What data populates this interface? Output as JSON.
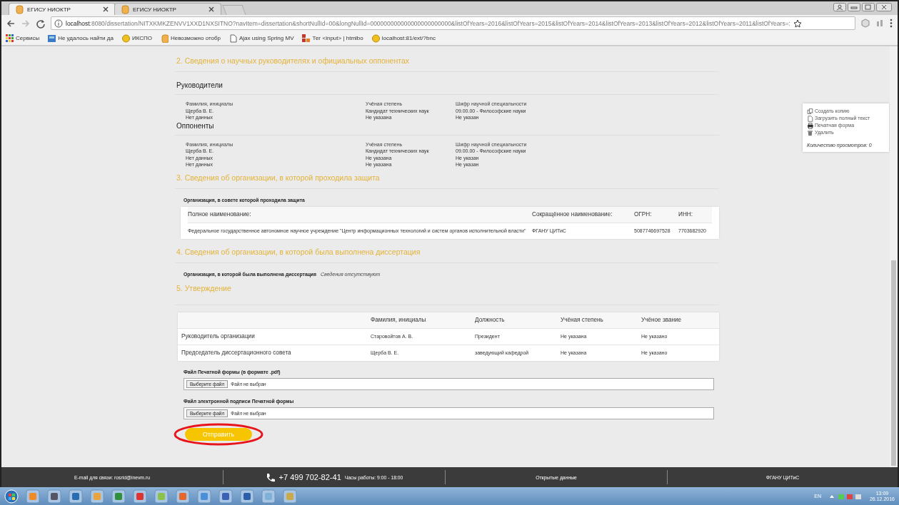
{
  "browser": {
    "tabs": [
      {
        "title": "ЕГИСУ НИОКТР",
        "selected": true
      },
      {
        "title": "ЕГИСУ НИОКТР",
        "selected": false
      }
    ],
    "address_host": "localhost",
    "address_path": ":8080/dissertation/NITXKMKZENVV1XXD1NXSITNO?navItem=dissertation&shortNullId=00&longNullId=000000000000000000000000&listOfYears=2016&listOfYears=2015&listOfYears=2014&listOfYears=2013&listOfYears=2012&listOfYears=2011&listOfYears=:",
    "bookmarks": [
      "Сервисы",
      "Не удалось найти да",
      "ИКСПО",
      "Невозможно отобр",
      "Ajax using Spring MV",
      "Тег <input> | htmlbo",
      "localhost:81/ext/?bnc"
    ]
  },
  "section_2": {
    "title": "2. Сведения о научных руководителях и официальных оппонентах",
    "groups": [
      {
        "heading": "Руководители",
        "columns": [
          "Фамилия, инициалы",
          "Учёная степень",
          "Шифр научной специальности"
        ],
        "rows": [
          [
            "Щерба В. Е.",
            "Кандидат технических наук",
            "09.00.00 - Философские науки"
          ],
          [
            "Нет данных",
            "Не указана",
            "Не указан"
          ]
        ]
      },
      {
        "heading": "Оппоненты",
        "columns": [
          "Фамилия, инициалы",
          "Учёная степень",
          "Шифр научной специальности"
        ],
        "rows": [
          [
            "Щерба В. Е.",
            "Кандидат технических наук",
            "09.00.00 - Философские науки"
          ],
          [
            "Нет данных",
            "Не указана",
            "Не указан"
          ],
          [
            "Нет данных",
            "Не указана",
            "Не указан"
          ]
        ]
      }
    ]
  },
  "section_3": {
    "title": "3. Сведения об организации, в которой проходила защита",
    "subheading": "Организация, в совете которой проходила защита",
    "columns": [
      "Полное наименование:",
      "Сокращённое наименование:",
      "ОГРН:",
      "ИНН:"
    ],
    "rows": [
      [
        "Федеральное государственное автономное научное учреждение \"Центр информационных технологий и систем органов исполнительной власти\"",
        "ФГАНУ ЦИТиС",
        "5087746697528",
        "7703682920"
      ]
    ]
  },
  "section_4": {
    "title": "4. Сведения об организации, в которой была выполнена диссертация",
    "label": "Организация, в которой была выполнена диссертация",
    "value": "Сведения отсутствуют"
  },
  "section_5": {
    "title": "5. Утверждение",
    "columns": [
      "",
      "Фамилия, инициалы",
      "Должность",
      "Учёная степень",
      "Учёное звание"
    ],
    "rows": [
      [
        "Руководитель организации",
        "Старовойтов А. В.",
        "Президент",
        "Не указана",
        "Не указано"
      ],
      [
        "Председатель диссертационного совета",
        "Щерба В. Е.",
        "заведующий кафедрой",
        "Не указана",
        "Не указано"
      ]
    ]
  },
  "files": [
    {
      "label": "Файл Печатной формы (в формате .pdf)",
      "button": "Выберите файл",
      "status": "Файл не выбран"
    },
    {
      "label": "Файл электронной подписи Печатной формы",
      "button": "Выберите файл",
      "status": "Файл не выбран"
    }
  ],
  "submit": "Отправить",
  "side_panel": {
    "actions": [
      {
        "kind": "copy",
        "label": "Создать копию"
      },
      {
        "kind": "document",
        "label": "Загрузить полный текст"
      },
      {
        "kind": "print",
        "label": "Печатная форма"
      },
      {
        "kind": "delete",
        "label": "Удалить"
      }
    ],
    "views": "Количество просмотров: 0"
  },
  "footer": {
    "email": "E-mail для связи: rosrid@inevm.ru",
    "phone": "+7 499 702-82-41",
    "hours": "Часы работы: 9:00 - 18:00",
    "open_data": "Открытые данные",
    "org": "ФГАНУ ЦИТиС"
  },
  "taskbar": {
    "language": "EN",
    "time": "13:09",
    "date": "26.12.2016"
  }
}
